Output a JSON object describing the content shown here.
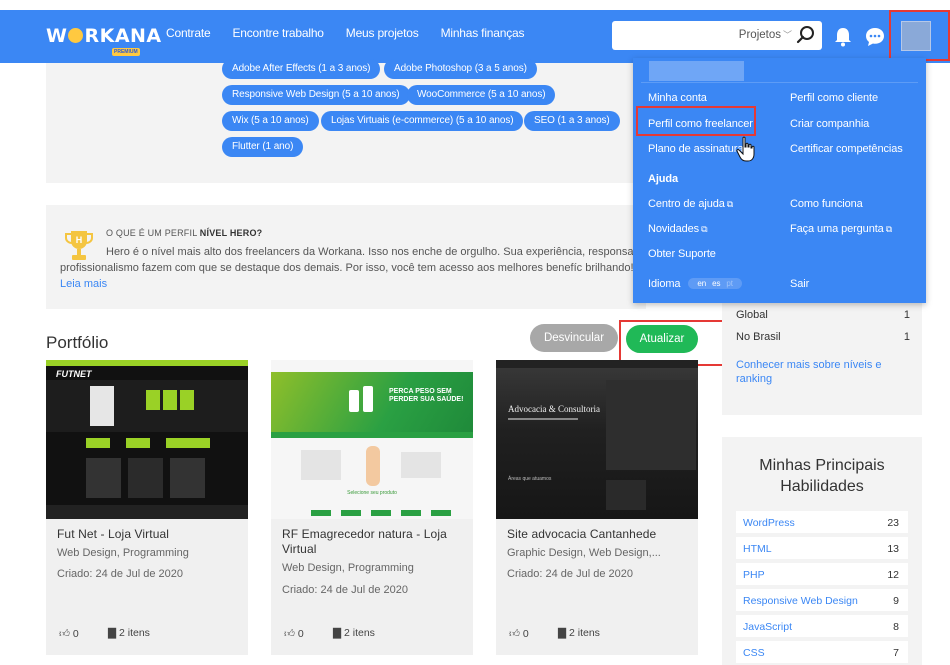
{
  "header": {
    "logo_text": "WORKANA",
    "logo_badge": "PREMIUM",
    "nav": [
      "Contrate",
      "Encontre trabalho",
      "Meus projetos",
      "Minhas finanças"
    ],
    "search_scope": "Projetos",
    "icons": [
      "search-icon",
      "bell-icon",
      "chat-icon",
      "avatar"
    ]
  },
  "tags": [
    "Adobe After Effects (1 a 3 anos)",
    "Adobe Photoshop (3 a 5 anos)",
    "Responsive Web Design (5 a 10 anos)",
    "WooCommerce (5 a 10 anos)",
    "Wix (5 a 10 anos)",
    "Lojas Virtuais (e-commerce) (5 a 10 anos)",
    "SEO (1 a 3 anos)",
    "Flutter (1 ano)"
  ],
  "hero": {
    "title_prefix": "O QUE É UM PERFIL",
    "title_bold": "NÍVEL HERO?",
    "text": "Hero é o nível mais alto dos freelancers da Workana. Isso nos enche de orgulho. Sua experiência, responsa profissionalismo fazem com que se destaque dos demais. Por isso, você tem acesso aos melhores benefíc brilhando!",
    "link": "Leia mais"
  },
  "portfolio": {
    "title": "Portfólio",
    "btn_unlink": "Desvincular",
    "btn_update": "Atualizar",
    "items": [
      {
        "name": "Fut Net - Loja Virtual",
        "categories": "Web Design, Programming",
        "date": "Criado: 24 de Jul de 2020",
        "likes": "0",
        "files": "2 itens"
      },
      {
        "name": "RF Emagrecedor natura - Loja Virtual",
        "categories": "Web Design, Programming",
        "date": "Criado: 24 de Jul de 2020",
        "likes": "0",
        "files": "2 itens"
      },
      {
        "name": "Site advocacia Cantanhede",
        "categories": "Graphic Design, Web Design,...",
        "date": "Criado: 24 de Jul de 2020",
        "likes": "0",
        "files": "2 itens"
      }
    ],
    "thumb_texts": {
      "t1_brand": "FUTNET",
      "t2_headline": "PERCA PESO SEM PERDER SUA SAÚDE!",
      "t2_sub": "Selecione seu produto",
      "t3_title": "Advocacia & Consultoria",
      "t3_sub": "Áreas que atuamos"
    }
  },
  "menu": {
    "left": [
      "Minha conta",
      "Perfil como freelancer",
      "Plano de assinatura",
      "Ajuda",
      "Centro de ajuda",
      "Novidades",
      "Obter Suporte",
      "Idioma"
    ],
    "right": [
      "Perfil como cliente",
      "Criar companhia",
      "Certificar competências",
      "Como funciona",
      "Faça uma pergunta",
      "Sair"
    ],
    "languages": [
      "en",
      "es",
      "pt"
    ]
  },
  "ranking": {
    "rows": [
      {
        "label": "Global",
        "value": "1"
      },
      {
        "label": "No Brasil",
        "value": "1"
      }
    ],
    "link": "Conhecer mais sobre níveis e ranking"
  },
  "skills": {
    "title": "Minhas Principais Habilidades",
    "items": [
      {
        "name": "WordPress",
        "count": "23"
      },
      {
        "name": "HTML",
        "count": "13"
      },
      {
        "name": "PHP",
        "count": "12"
      },
      {
        "name": "Responsive Web Design",
        "count": "9"
      },
      {
        "name": "JavaScript",
        "count": "8"
      },
      {
        "name": "CSS",
        "count": "7"
      }
    ]
  },
  "colors": {
    "brand": "#3b87f4",
    "green": "#20b957",
    "grey_card": "#f3f3f3",
    "highlight": "#e53935"
  }
}
